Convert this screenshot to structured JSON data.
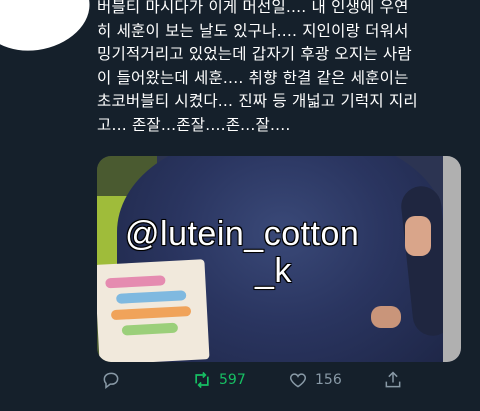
{
  "tweet": {
    "lines": [
      "버블티 마시다가 이게 머선일.... 내 인생에 우연",
      "히 세훈이 보는 날도 있구나.... 지인이랑 더워서",
      "밍기적거리고 있었는데 갑자기 후광 오지는 사람",
      "이 들어왔는데 세훈.... 취향 한결 같은 세훈이는",
      "초코버블티 시켰다... 진짜 등 개넓고 기럭지 지리",
      "고... 존잘...존잘....존...잘...."
    ]
  },
  "media": {
    "watermark_line1": "@lutein_cotton",
    "watermark_line2": "_k"
  },
  "actions": {
    "reply_icon": "reply-icon",
    "retweet_icon": "retweet-icon",
    "retweet_count": "597",
    "like_icon": "heart-icon",
    "like_count": "156",
    "share_icon": "share-icon"
  },
  "colors": {
    "background": "#15202b",
    "text": "#ffffff",
    "muted": "#8899a6",
    "retweeted": "#17bf63"
  }
}
